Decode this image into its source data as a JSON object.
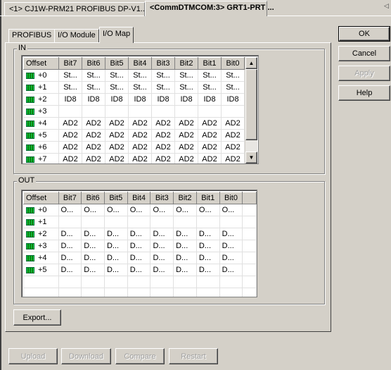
{
  "doc_tabs": [
    {
      "label": "<1> CJ1W-PRM21 PROFIBUS DP-V1...",
      "active": false
    },
    {
      "label": "<CommDTMCOM:3> GRT1-PRT ...",
      "active": true
    }
  ],
  "tabs": [
    {
      "label": "PROFIBUS"
    },
    {
      "label": "I/O Module"
    },
    {
      "label": "I/O Map",
      "active": true
    }
  ],
  "side_buttons": {
    "ok": "OK",
    "cancel": "Cancel",
    "apply": "Apply",
    "help": "Help"
  },
  "columns": [
    "Offset",
    "Bit7",
    "Bit6",
    "Bit5",
    "Bit4",
    "Bit3",
    "Bit2",
    "Bit1",
    "Bit0"
  ],
  "in": {
    "label": "IN",
    "rows": [
      {
        "offset": "+0",
        "cells": [
          "St...",
          "St...",
          "St...",
          "St...",
          "St...",
          "St...",
          "St...",
          "St..."
        ]
      },
      {
        "offset": "+1",
        "cells": [
          "St...",
          "St...",
          "St...",
          "St...",
          "St...",
          "St...",
          "St...",
          "St..."
        ]
      },
      {
        "offset": "+2",
        "cells": [
          "ID8",
          "ID8",
          "ID8",
          "ID8",
          "ID8",
          "ID8",
          "ID8",
          "ID8"
        ]
      },
      {
        "offset": "+3",
        "cells": [
          "",
          "",
          "",
          "",
          "",
          "",
          "",
          ""
        ]
      },
      {
        "offset": "+4",
        "cells": [
          "AD2",
          "AD2",
          "AD2",
          "AD2",
          "AD2",
          "AD2",
          "AD2",
          "AD2"
        ]
      },
      {
        "offset": "+5",
        "cells": [
          "AD2",
          "AD2",
          "AD2",
          "AD2",
          "AD2",
          "AD2",
          "AD2",
          "AD2"
        ]
      },
      {
        "offset": "+6",
        "cells": [
          "AD2",
          "AD2",
          "AD2",
          "AD2",
          "AD2",
          "AD2",
          "AD2",
          "AD2"
        ]
      },
      {
        "offset": "+7",
        "cells": [
          "AD2",
          "AD2",
          "AD2",
          "AD2",
          "AD2",
          "AD2",
          "AD2",
          "AD2"
        ]
      }
    ]
  },
  "out": {
    "label": "OUT",
    "rows": [
      {
        "offset": "+0",
        "cells": [
          "O...",
          "O...",
          "O...",
          "O...",
          "O...",
          "O...",
          "O...",
          "O..."
        ]
      },
      {
        "offset": "+1",
        "cells": [
          "",
          "",
          "",
          "",
          "",
          "",
          "",
          ""
        ]
      },
      {
        "offset": "+2",
        "cells": [
          "D...",
          "D...",
          "D...",
          "D...",
          "D...",
          "D...",
          "D...",
          "D..."
        ]
      },
      {
        "offset": "+3",
        "cells": [
          "D...",
          "D...",
          "D...",
          "D...",
          "D...",
          "D...",
          "D...",
          "D..."
        ]
      },
      {
        "offset": "+4",
        "cells": [
          "D...",
          "D...",
          "D...",
          "D...",
          "D...",
          "D...",
          "D...",
          "D..."
        ]
      },
      {
        "offset": "+5",
        "cells": [
          "D...",
          "D...",
          "D...",
          "D...",
          "D...",
          "D...",
          "D...",
          "D..."
        ]
      }
    ]
  },
  "export_label": "Export...",
  "bottom_buttons": {
    "upload": "Upload",
    "download": "Download",
    "compare": "Compare",
    "restart": "Restart"
  },
  "icons": {
    "module": "io-module-icon",
    "scroll_up": "▲",
    "scroll_down": "▼",
    "tab_scroll": "◁"
  }
}
